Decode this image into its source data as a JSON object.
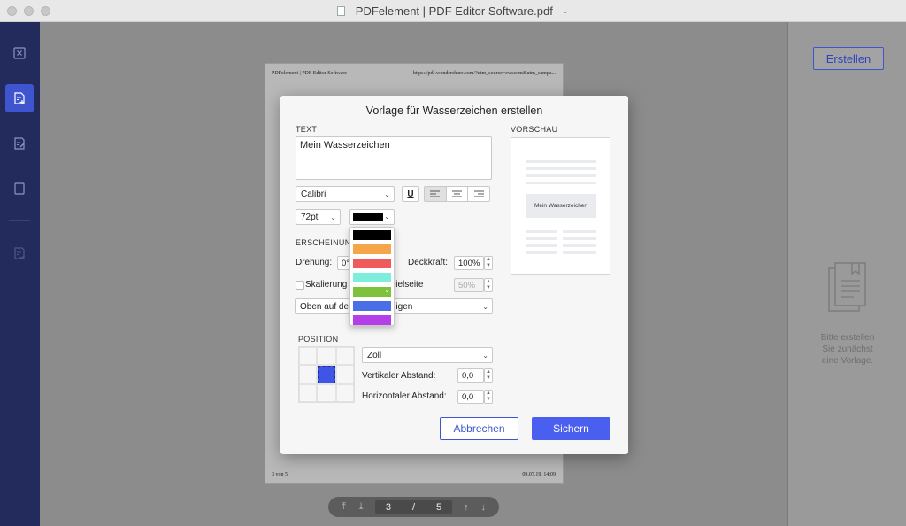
{
  "window": {
    "title": "PDFelement | PDF Editor Software.pdf"
  },
  "sidebar": {
    "items": [
      {
        "icon": "close-doc-icon"
      },
      {
        "icon": "add-page-icon",
        "active": true
      },
      {
        "icon": "edit-page-icon"
      },
      {
        "icon": "blank-page-icon"
      },
      {
        "icon": "checklist-page-icon"
      }
    ]
  },
  "page": {
    "header_left": "PDFelement | PDF Editor Software",
    "header_right": "https://pdf.wondershare.com/?utm_source=ewscom&utm_campa...",
    "footer_left": "3 von 5",
    "footer_right": "09.07.19, 14:09"
  },
  "pagenav": {
    "current": "3",
    "separator": "/",
    "total": "5"
  },
  "right_panel": {
    "create_label": "Erstellen",
    "empty_text_1": "Bitte erstellen",
    "empty_text_2": "Sie zunächst",
    "empty_text_3": "eine Vorlage."
  },
  "dialog": {
    "title": "Vorlage für Wasserzeichen erstellen",
    "text_section": "TEXT",
    "text_value": "Mein Wasserzeichen",
    "font": "Calibri",
    "underline_label": "U",
    "size": "72pt",
    "appearance_section": "ERSCHEINUNG",
    "rotation_label": "Drehung:",
    "rotation_value": "0°",
    "opacity_label": "Deckkraft:",
    "opacity_value": "100%",
    "scale_label": "Skalierung relativ zur Zielseite",
    "scale_value": "50%",
    "layer_value": "Oben auf der Seite anzeigen",
    "position_section": "POSITION",
    "unit": "Zoll",
    "vertical_label": "Vertikaler Abstand:",
    "vertical_value": "0,0",
    "horizontal_label": "Horizontaler Abstand:",
    "horizontal_value": "0,0",
    "preview_section": "VORSCHAU",
    "preview_text": "Mein Wasserzeichen",
    "cancel_label": "Abbrechen",
    "save_label": "Sichern",
    "selected_color": "#000000",
    "color_options": [
      "#000000",
      "#f5a54a",
      "#ef5b5b",
      "#7eeedc",
      "#7ec13c",
      "#4a6de8",
      "#b43ee8"
    ]
  }
}
